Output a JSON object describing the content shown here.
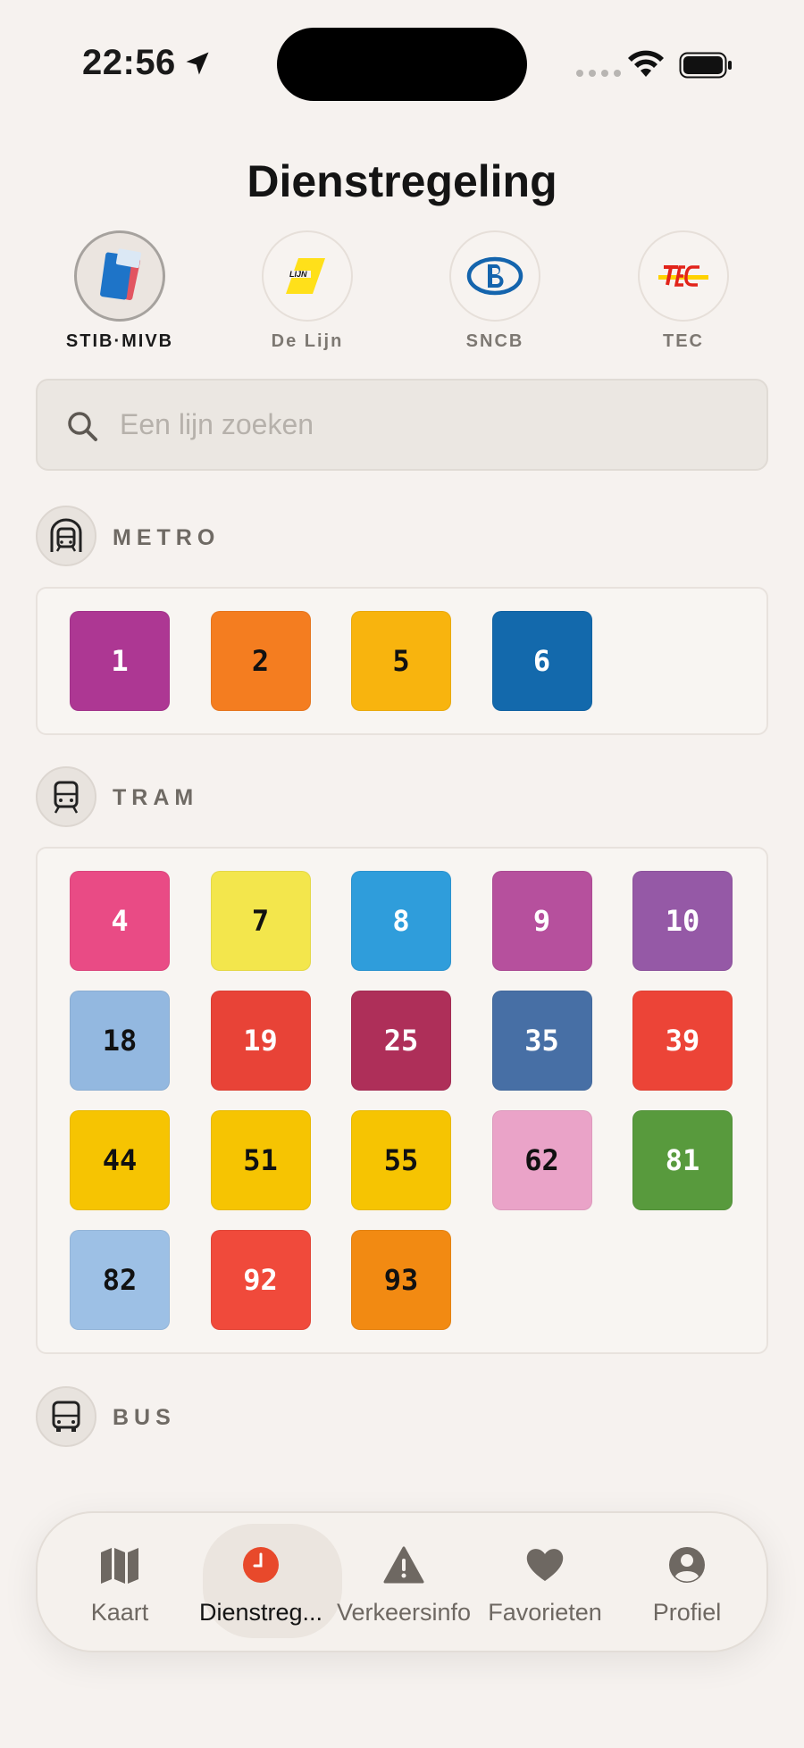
{
  "status_bar": {
    "time": "22:56"
  },
  "title": "Dienstregeling",
  "operators": [
    {
      "label": "STIB·MIVB",
      "active": true
    },
    {
      "label": "De Lijn",
      "active": false
    },
    {
      "label": "SNCB",
      "active": false
    },
    {
      "label": "TEC",
      "active": false
    }
  ],
  "search": {
    "placeholder": "Een lijn zoeken"
  },
  "sections": {
    "metro": {
      "label": "METRO",
      "lines": [
        {
          "number": "1",
          "color": "#ad3793",
          "text_color": "#ffffff"
        },
        {
          "number": "2",
          "color": "#f47d20",
          "text_color": "#111111"
        },
        {
          "number": "5",
          "color": "#f8b40e",
          "text_color": "#111111"
        },
        {
          "number": "6",
          "color": "#1369ac",
          "text_color": "#ffffff"
        }
      ]
    },
    "tram": {
      "label": "TRAM",
      "lines": [
        {
          "number": "4",
          "color": "#e94b85",
          "text_color": "#ffffff"
        },
        {
          "number": "7",
          "color": "#f3e64c",
          "text_color": "#111111"
        },
        {
          "number": "8",
          "color": "#2f9ddb",
          "text_color": "#ffffff"
        },
        {
          "number": "9",
          "color": "#b6509d",
          "text_color": "#ffffff"
        },
        {
          "number": "10",
          "color": "#9559a6",
          "text_color": "#ffffff"
        },
        {
          "number": "18",
          "color": "#93b8e0",
          "text_color": "#111111"
        },
        {
          "number": "19",
          "color": "#e84337",
          "text_color": "#ffffff"
        },
        {
          "number": "25",
          "color": "#ae2f59",
          "text_color": "#ffffff"
        },
        {
          "number": "35",
          "color": "#476fa5",
          "text_color": "#ffffff"
        },
        {
          "number": "39",
          "color": "#ec4437",
          "text_color": "#ffffff"
        },
        {
          "number": "44",
          "color": "#f6c402",
          "text_color": "#111111"
        },
        {
          "number": "51",
          "color": "#f6c402",
          "text_color": "#111111"
        },
        {
          "number": "55",
          "color": "#f6c402",
          "text_color": "#111111"
        },
        {
          "number": "62",
          "color": "#eaa3c8",
          "text_color": "#111111"
        },
        {
          "number": "81",
          "color": "#589a3d",
          "text_color": "#ffffff"
        },
        {
          "number": "82",
          "color": "#9dc0e5",
          "text_color": "#111111"
        },
        {
          "number": "92",
          "color": "#f04a3b",
          "text_color": "#ffffff"
        },
        {
          "number": "93",
          "color": "#f28a12",
          "text_color": "#111111"
        }
      ]
    },
    "bus": {
      "label": "BUS"
    }
  },
  "tabbar": [
    {
      "label": "Kaart",
      "icon": "map-icon",
      "active": false
    },
    {
      "label": "Dienstreg...",
      "icon": "clock-icon",
      "active": true
    },
    {
      "label": "Verkeersinfo",
      "icon": "warning-icon",
      "active": false
    },
    {
      "label": "Favorieten",
      "icon": "heart-icon",
      "active": false
    },
    {
      "label": "Profiel",
      "icon": "profile-icon",
      "active": false
    }
  ],
  "colors": {
    "accent": "#e8492b",
    "background": "#f6f2ef"
  }
}
